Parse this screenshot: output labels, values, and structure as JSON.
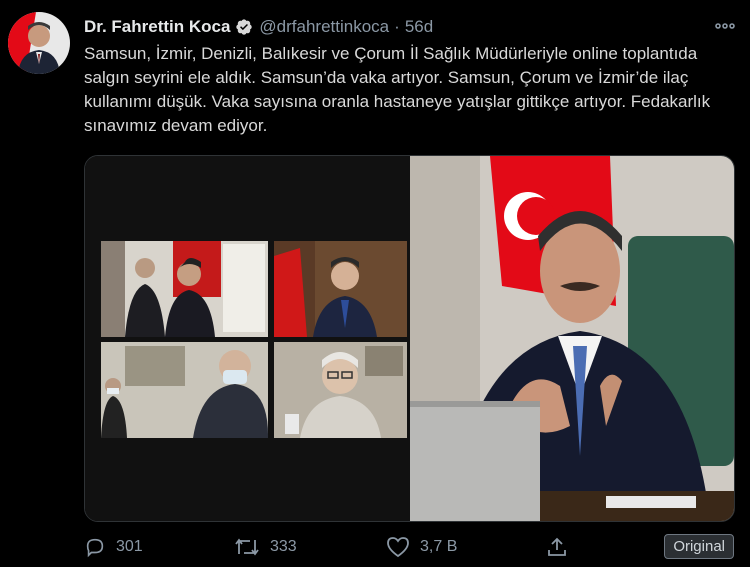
{
  "tweet": {
    "author_name": "Dr. Fahrettin Koca",
    "handle": "@drfahrettinkoca",
    "separator": "·",
    "time": "56d",
    "text": "Samsun, İzmir, Denizli, Balıkesir ve Çorum İl Sağlık Müdürleriyle online toplantıda salgın seyrini ele aldık. Samsun’da vaka artıyor. Samsun, Çorum ve İzmir’de ilaç kullanımı düşük. Vaka sayısına oranla hastaneye yatışlar gittikçe artıyor. Fedakarlık sınavımız devam ediyor."
  },
  "actions": {
    "reply_count": "301",
    "retweet_count": "333",
    "like_count": "3,7 B"
  },
  "badge": {
    "label": "Original"
  },
  "colors": {
    "background": "#000000",
    "verified": "#d9d9d9",
    "flag_red": "#e30a17",
    "muted": "#8b98a5"
  },
  "icons": [
    "verified-icon",
    "more-icon",
    "reply-icon",
    "retweet-icon",
    "like-icon",
    "share-icon"
  ]
}
